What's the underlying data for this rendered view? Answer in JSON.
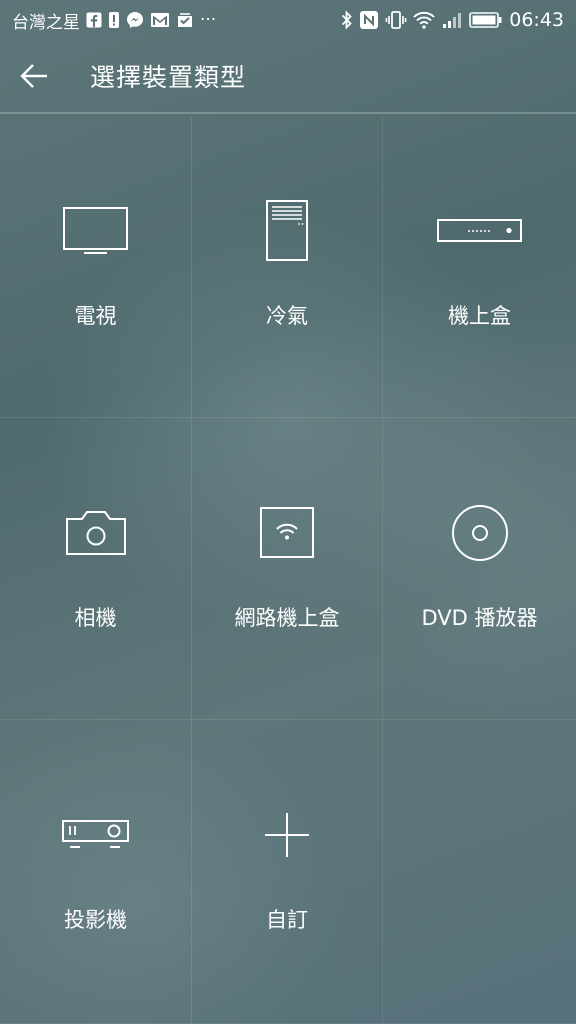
{
  "status_bar": {
    "carrier": "台灣之星",
    "time": "06:43",
    "left_icons": [
      "facebook-icon",
      "alert-icon",
      "messenger-icon",
      "gmail-icon",
      "inbox-icon",
      "more-icon"
    ],
    "right_icons": [
      "bluetooth-icon",
      "nfc-icon",
      "vibrate-icon",
      "wifi-icon",
      "signal-icon",
      "battery-icon"
    ],
    "more_glyph": "···"
  },
  "header": {
    "title": "選擇裝置類型",
    "back_icon": "back-arrow-icon"
  },
  "devices": [
    {
      "label": "電視",
      "icon": "tv-icon"
    },
    {
      "label": "冷氣",
      "icon": "air-conditioner-icon"
    },
    {
      "label": "機上盒",
      "icon": "set-top-box-icon"
    },
    {
      "label": "相機",
      "icon": "camera-icon"
    },
    {
      "label": "網路機上盒",
      "icon": "network-box-icon"
    },
    {
      "label": "DVD 播放器",
      "icon": "dvd-icon"
    },
    {
      "label": "投影機",
      "icon": "projector-icon"
    },
    {
      "label": "自訂",
      "icon": "plus-icon"
    }
  ]
}
